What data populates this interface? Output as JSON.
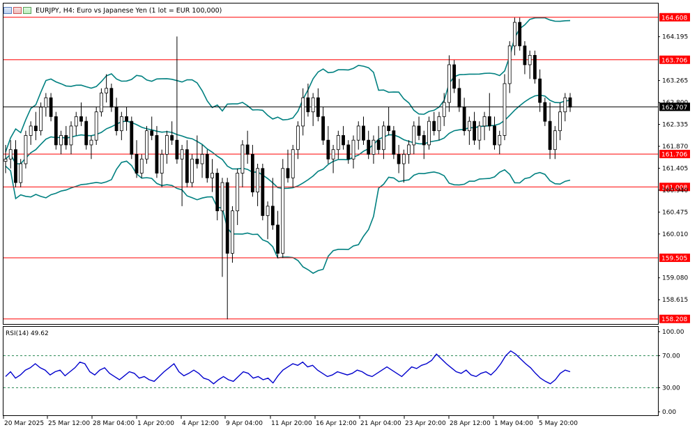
{
  "chart_data": [
    {
      "type": "candlestick",
      "title": "EURJPY, H4:  Euro vs Japanese Yen (1 lot = EUR 100,000)",
      "y_ticks": [
        "164.195",
        "163.265",
        "162.800",
        "162.335",
        "161.870",
        "161.405",
        "160.940",
        "160.475",
        "160.010",
        "159.080",
        "158.615"
      ],
      "x_ticks": [
        "20 Mar 2025",
        "25 Mar 12:00",
        "28 Mar 04:00",
        "1 Apr 20:00",
        "4 Apr 12:00",
        "9 Apr 04:00",
        "11 Apr 20:00",
        "16 Apr 12:00",
        "21 Apr 04:00",
        "23 Apr 20:00",
        "28 Apr 12:00",
        "1 May 04:00",
        "5 May 20:00"
      ],
      "ylim": [
        158.1,
        164.9
      ],
      "horizontal_levels": [
        {
          "label": "164.608",
          "value": 164.608,
          "color": "#ff0000"
        },
        {
          "label": "163.706",
          "value": 163.706,
          "color": "#ff0000"
        },
        {
          "label": "161.706",
          "value": 161.706,
          "color": "#ff0000"
        },
        {
          "label": "161.008",
          "value": 161.008,
          "color": "#ff0000"
        },
        {
          "label": "159.505",
          "value": 159.505,
          "color": "#ff0000"
        },
        {
          "label": "158.208",
          "value": 158.208,
          "color": "#ff0000"
        }
      ],
      "current_price": {
        "label": "162.707",
        "value": 162.707
      },
      "candles_ohlc": [
        [
          161.55,
          161.9,
          161.3,
          161.6
        ],
        [
          161.6,
          162.0,
          161.4,
          161.8
        ],
        [
          161.8,
          162.0,
          161.0,
          161.1
        ],
        [
          161.1,
          161.6,
          161.0,
          161.5
        ],
        [
          161.5,
          162.2,
          161.4,
          162.1
        ],
        [
          162.1,
          162.4,
          161.9,
          162.3
        ],
        [
          162.3,
          162.6,
          162.0,
          162.2
        ],
        [
          162.2,
          162.8,
          162.1,
          162.7
        ],
        [
          162.7,
          163.0,
          162.5,
          162.9
        ],
        [
          162.9,
          163.0,
          162.4,
          162.5
        ],
        [
          162.5,
          162.6,
          161.8,
          161.9
        ],
        [
          161.9,
          162.2,
          161.7,
          162.1
        ],
        [
          162.1,
          162.3,
          161.8,
          161.9
        ],
        [
          161.9,
          162.4,
          161.7,
          162.3
        ],
        [
          162.3,
          162.6,
          162.1,
          162.5
        ],
        [
          162.5,
          162.8,
          162.3,
          162.4
        ],
        [
          162.4,
          162.5,
          161.8,
          161.9
        ],
        [
          161.9,
          162.1,
          161.6,
          162.0
        ],
        [
          162.0,
          162.7,
          161.9,
          162.6
        ],
        [
          162.6,
          163.1,
          162.5,
          163.0
        ],
        [
          163.0,
          163.4,
          162.8,
          163.1
        ],
        [
          163.1,
          163.2,
          162.6,
          162.7
        ],
        [
          162.7,
          162.9,
          162.1,
          162.2
        ],
        [
          162.2,
          162.6,
          162.0,
          162.5
        ],
        [
          162.5,
          162.7,
          162.2,
          162.4
        ],
        [
          162.4,
          162.5,
          161.6,
          161.7
        ],
        [
          161.7,
          162.0,
          161.2,
          161.3
        ],
        [
          161.3,
          161.7,
          161.2,
          161.6
        ],
        [
          161.6,
          162.3,
          161.5,
          162.2
        ],
        [
          162.2,
          162.5,
          162.0,
          162.1
        ],
        [
          162.1,
          162.3,
          161.2,
          161.3
        ],
        [
          161.3,
          161.8,
          161.0,
          161.7
        ],
        [
          161.7,
          162.2,
          161.5,
          162.1
        ],
        [
          162.1,
          162.4,
          161.9,
          162.0
        ],
        [
          162.0,
          164.2,
          161.5,
          161.6
        ],
        [
          161.6,
          161.9,
          160.6,
          161.8
        ],
        [
          161.8,
          162.0,
          161.0,
          161.1
        ],
        [
          161.1,
          161.7,
          161.0,
          161.6
        ],
        [
          161.6,
          162.1,
          161.4,
          161.5
        ],
        [
          161.5,
          161.9,
          161.2,
          161.7
        ],
        [
          161.7,
          161.8,
          161.1,
          161.2
        ],
        [
          161.2,
          161.6,
          160.9,
          161.3
        ],
        [
          161.3,
          161.4,
          160.3,
          160.5
        ],
        [
          160.5,
          161.2,
          159.1,
          161.1
        ],
        [
          161.1,
          161.2,
          158.2,
          159.6
        ],
        [
          159.6,
          160.6,
          159.4,
          160.5
        ],
        [
          160.5,
          161.4,
          160.2,
          161.3
        ],
        [
          161.3,
          162.0,
          161.0,
          161.9
        ],
        [
          161.9,
          162.2,
          161.5,
          161.7
        ],
        [
          161.7,
          161.9,
          160.8,
          160.9
        ],
        [
          160.9,
          161.5,
          160.6,
          161.4
        ],
        [
          161.4,
          161.5,
          160.3,
          160.4
        ],
        [
          160.4,
          160.7,
          159.9,
          160.6
        ],
        [
          160.6,
          161.2,
          160.1,
          160.2
        ],
        [
          160.2,
          160.5,
          159.5,
          159.6
        ],
        [
          159.6,
          161.6,
          159.5,
          161.4
        ],
        [
          161.4,
          161.8,
          161.1,
          161.2
        ],
        [
          161.2,
          161.9,
          161.0,
          161.8
        ],
        [
          161.8,
          162.4,
          161.6,
          162.3
        ],
        [
          162.3,
          163.1,
          162.1,
          162.9
        ],
        [
          162.9,
          163.2,
          162.5,
          162.6
        ],
        [
          162.6,
          163.0,
          162.3,
          162.9
        ],
        [
          162.9,
          163.1,
          162.4,
          162.5
        ],
        [
          162.5,
          162.7,
          161.9,
          162.0
        ],
        [
          162.0,
          162.3,
          161.5,
          161.6
        ],
        [
          161.6,
          161.9,
          161.3,
          161.8
        ],
        [
          161.8,
          162.2,
          161.6,
          162.1
        ],
        [
          162.1,
          162.3,
          161.8,
          161.9
        ],
        [
          161.9,
          162.0,
          161.5,
          161.6
        ],
        [
          161.6,
          162.1,
          161.4,
          162.0
        ],
        [
          162.0,
          162.4,
          161.8,
          162.3
        ],
        [
          162.3,
          162.5,
          161.9,
          162.0
        ],
        [
          162.0,
          162.2,
          161.6,
          161.7
        ],
        [
          161.7,
          162.1,
          161.5,
          162.0
        ],
        [
          162.0,
          162.3,
          161.7,
          161.8
        ],
        [
          161.8,
          162.4,
          161.6,
          162.3
        ],
        [
          162.3,
          162.7,
          162.1,
          162.2
        ],
        [
          162.2,
          162.3,
          161.6,
          161.7
        ],
        [
          161.7,
          161.9,
          161.3,
          161.5
        ],
        [
          161.5,
          161.8,
          161.1,
          161.7
        ],
        [
          161.7,
          162.0,
          161.5,
          161.9
        ],
        [
          161.9,
          162.4,
          161.7,
          162.3
        ],
        [
          162.3,
          162.5,
          162.0,
          162.1
        ],
        [
          162.1,
          162.2,
          161.6,
          161.9
        ],
        [
          161.9,
          162.5,
          161.8,
          162.4
        ],
        [
          162.4,
          162.6,
          162.1,
          162.2
        ],
        [
          162.2,
          162.6,
          162.0,
          162.5
        ],
        [
          162.5,
          163.0,
          162.3,
          162.8
        ],
        [
          162.8,
          163.8,
          162.6,
          163.6
        ],
        [
          163.6,
          163.7,
          163.0,
          163.1
        ],
        [
          163.1,
          163.3,
          162.6,
          162.7
        ],
        [
          162.7,
          162.9,
          162.1,
          162.2
        ],
        [
          162.2,
          162.5,
          161.9,
          162.4
        ],
        [
          162.4,
          162.6,
          161.9,
          162.0
        ],
        [
          162.0,
          162.4,
          161.8,
          162.3
        ],
        [
          162.3,
          162.6,
          162.0,
          162.5
        ],
        [
          162.5,
          163.0,
          162.2,
          162.3
        ],
        [
          162.3,
          162.5,
          161.8,
          161.9
        ],
        [
          161.9,
          162.2,
          161.7,
          162.1
        ],
        [
          162.1,
          163.4,
          162.0,
          163.2
        ],
        [
          163.2,
          164.1,
          163.0,
          164.0
        ],
        [
          164.0,
          164.6,
          163.8,
          164.5
        ],
        [
          164.5,
          164.6,
          163.9,
          164.0
        ],
        [
          164.0,
          164.1,
          163.4,
          163.6
        ],
        [
          163.6,
          163.9,
          163.3,
          163.8
        ],
        [
          163.8,
          163.9,
          163.2,
          163.3
        ],
        [
          163.3,
          163.5,
          162.6,
          162.8
        ],
        [
          162.8,
          162.9,
          162.3,
          162.4
        ],
        [
          162.4,
          162.8,
          161.6,
          161.8
        ],
        [
          161.8,
          162.3,
          161.6,
          162.2
        ],
        [
          162.2,
          162.8,
          162.0,
          162.6
        ],
        [
          162.6,
          163.0,
          162.4,
          162.9
        ],
        [
          162.9,
          163.0,
          162.6,
          162.7
        ]
      ]
    },
    {
      "type": "line",
      "title": "RSI(14) 49.62",
      "y_ticks": [
        "100.00",
        "70.00",
        "30.00",
        "0.00"
      ],
      "ylim": [
        0,
        100
      ],
      "levels": [
        70,
        30
      ],
      "series": [
        {
          "color": "#0000cd",
          "values": [
            44,
            50,
            42,
            46,
            52,
            55,
            60,
            55,
            52,
            46,
            50,
            52,
            45,
            50,
            55,
            62,
            60,
            50,
            46,
            52,
            55,
            48,
            44,
            40,
            45,
            50,
            48,
            42,
            44,
            40,
            38,
            44,
            50,
            55,
            60,
            50,
            45,
            48,
            52,
            48,
            42,
            40,
            35,
            40,
            44,
            40,
            38,
            44,
            50,
            48,
            42,
            44,
            40,
            42,
            36,
            45,
            52,
            56,
            60,
            58,
            62,
            56,
            58,
            52,
            48,
            44,
            46,
            50,
            48,
            46,
            48,
            52,
            50,
            46,
            44,
            48,
            52,
            56,
            52,
            48,
            44,
            50,
            56,
            54,
            58,
            60,
            64,
            72,
            66,
            60,
            55,
            50,
            48,
            52,
            46,
            44,
            48,
            50,
            46,
            52,
            60,
            70,
            76,
            72,
            66,
            60,
            55,
            48,
            42,
            38,
            35,
            40,
            48,
            52,
            50
          ]
        }
      ]
    }
  ],
  "bollinger_color": "#008080",
  "candle_color": "#000000"
}
